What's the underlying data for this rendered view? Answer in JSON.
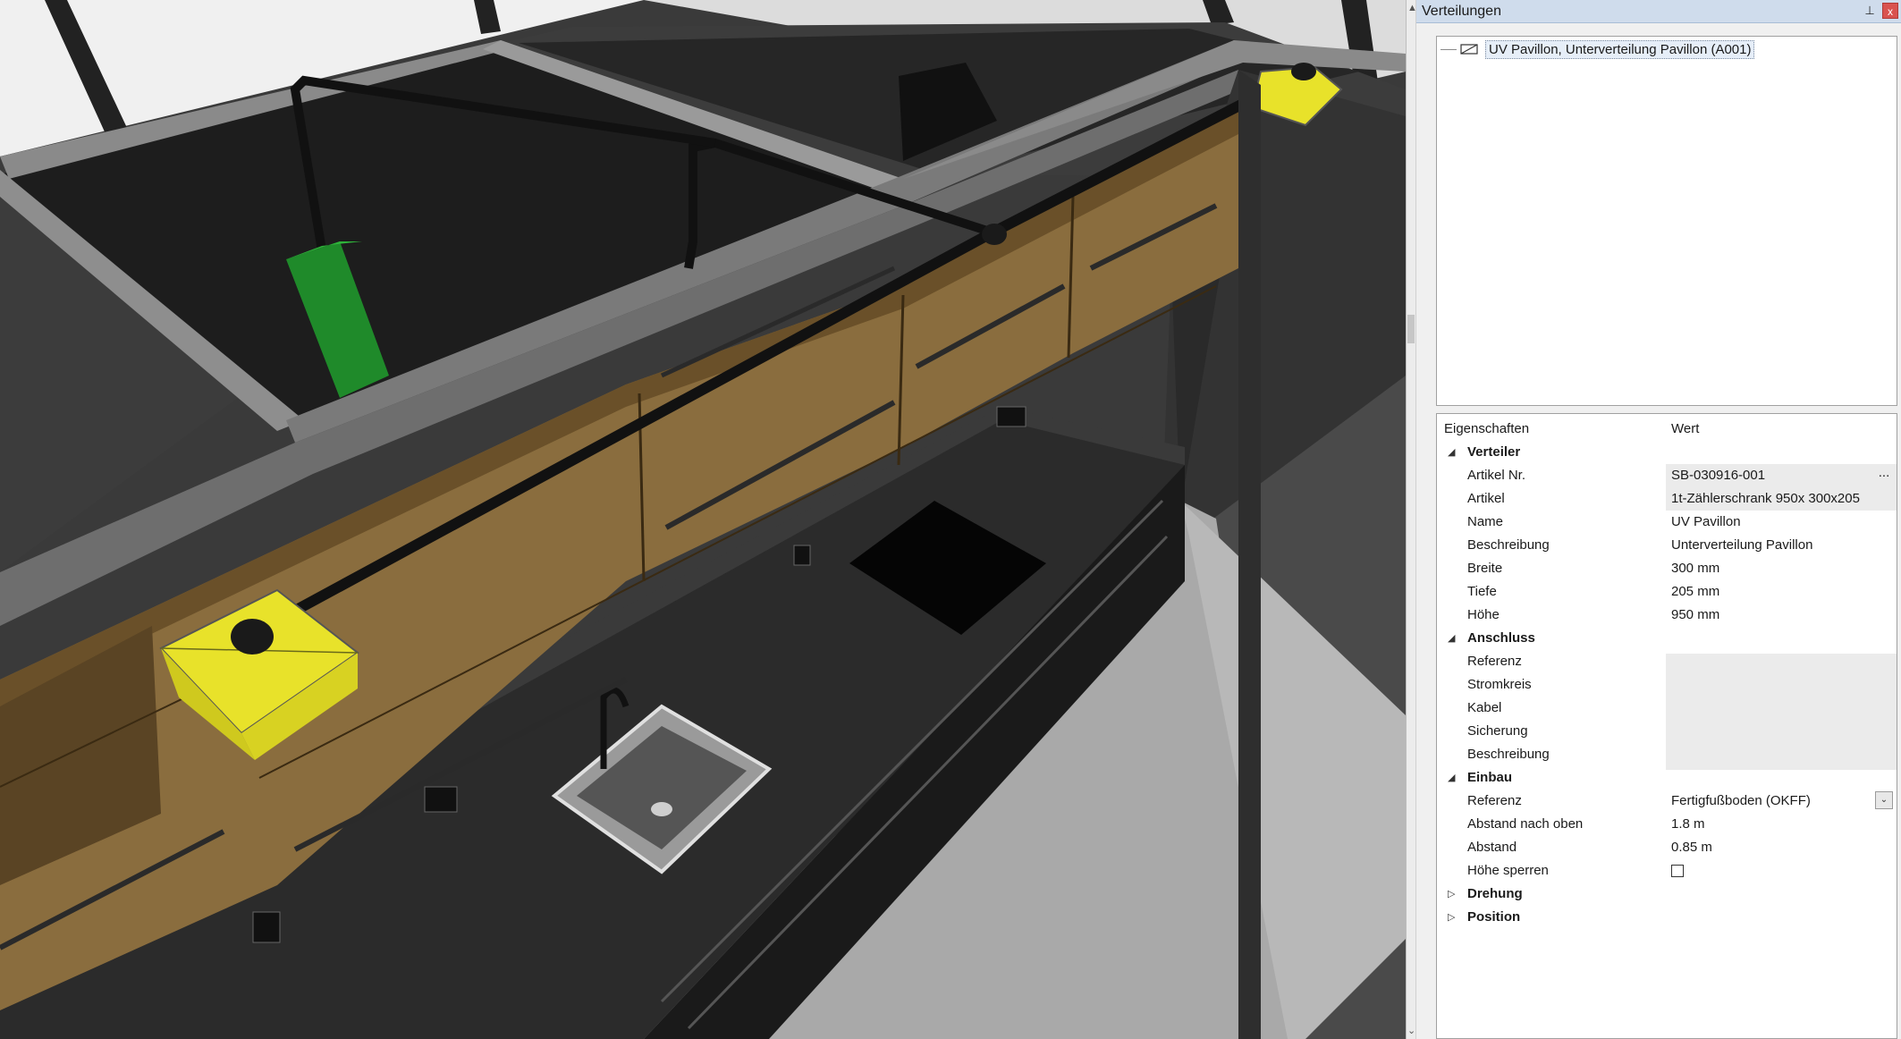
{
  "panel": {
    "title": "Verteilungen",
    "pin_glyph": "⊥",
    "close_glyph": "x"
  },
  "tree": {
    "item_label": "UV Pavillon, Unterverteilung Pavillon (A001)"
  },
  "properties": {
    "header": {
      "name": "Eigenschaften",
      "value": "Wert"
    },
    "verteiler": {
      "title": "Verteiler",
      "artikel_nr": {
        "label": "Artikel Nr.",
        "value": "SB-030916-001"
      },
      "artikel": {
        "label": "Artikel",
        "value": "1t-Zählerschrank  950x 300x205"
      },
      "name": {
        "label": "Name",
        "value": "UV Pavillon"
      },
      "beschreibung": {
        "label": "Beschreibung",
        "value": "Unterverteilung Pavillon"
      },
      "breite": {
        "label": "Breite",
        "value": "300 mm"
      },
      "tiefe": {
        "label": "Tiefe",
        "value": "205 mm"
      },
      "hoehe": {
        "label": "Höhe",
        "value": "950 mm"
      }
    },
    "anschluss": {
      "title": "Anschluss",
      "referenz": {
        "label": "Referenz"
      },
      "stromkreis": {
        "label": "Stromkreis"
      },
      "kabel": {
        "label": "Kabel"
      },
      "sicherung": {
        "label": "Sicherung"
      },
      "beschreibung": {
        "label": "Beschreibung"
      }
    },
    "einbau": {
      "title": "Einbau",
      "referenz": {
        "label": "Referenz",
        "value": "Fertigfußboden (OKFF)"
      },
      "abstand_oben": {
        "label": "Abstand nach oben",
        "value": "1.8 m"
      },
      "abstand": {
        "label": "Abstand",
        "value": "0.85 m"
      },
      "hoehe_sperren": {
        "label": "Höhe sperren",
        "checked": false
      }
    },
    "drehung": {
      "title": "Drehung"
    },
    "position": {
      "title": "Position"
    }
  },
  "icons": {
    "expanded": "◢",
    "collapsed": "▷",
    "ellipsis": "...",
    "dropdown": "⌄",
    "scroll_up": "▲",
    "scroll_down": "⌄"
  },
  "colors": {
    "cabinet": "#8a6d3e",
    "distribution_box": "#e8e22a",
    "green_box": "#1f8a2a",
    "header_bg": "#cfdcec"
  }
}
